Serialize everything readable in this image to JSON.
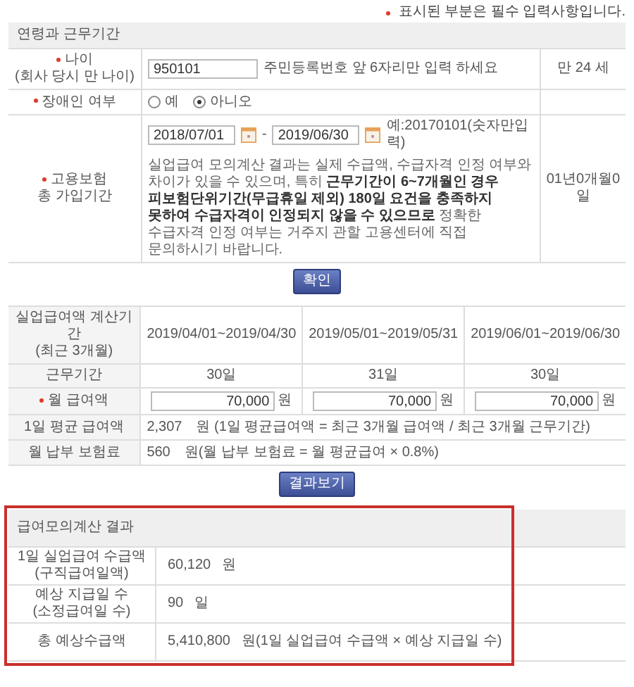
{
  "required_note": "표시된 부분은 필수 입력사항입니다.",
  "section": {
    "title": "연령과 근무기간",
    "age": {
      "label": [
        "나이",
        "(회사 당시 만 나이)"
      ],
      "required": true,
      "value": "950101",
      "hint": "주민등록번호 앞 6자리만 입력 하세요",
      "result": "만 24 세"
    },
    "disability": {
      "label": [
        "장애인 여부"
      ],
      "required": true,
      "options": [
        {
          "label": "예",
          "selected": false
        },
        {
          "label": "아니오",
          "selected": true
        }
      ]
    },
    "insurance": {
      "label": [
        "고용보험",
        "총 가입기간"
      ],
      "required": true,
      "date_from": "2018/07/01",
      "separator": "-",
      "date_to": "2019/06/30",
      "example": "예:20170101(숫자만입력)",
      "notice": "실업급여 모의계산 결과는 실제 수급액, 수급자격 인정 여부와 차이가 있을 수 있으며, 특히 **근무기간이 6~7개월인 경우 피보험단위기간(무급휴일 제외) 180일 요건을 충족하지 못하여 수급자격이 인정되지 않을 수 있으므로** 정확한 수급자격 인정 여부는 거주지 관할 고용센터에 직접 문의하시기 바랍니다.",
      "result": "01년0개월0일"
    }
  },
  "confirm_button": "확인",
  "pay_table": {
    "period_label": [
      "실업급여액 계산기간",
      "(최근 3개월)"
    ],
    "periods": [
      "2019/04/01~2019/04/30",
      "2019/05/01~2019/05/31",
      "2019/06/01~2019/06/30"
    ],
    "workdays_label": [
      "근무기간"
    ],
    "workdays": [
      "30일",
      "31일",
      "30일"
    ],
    "monthly_label": [
      "월 급여액"
    ],
    "monthly_required": true,
    "monthly": [
      {
        "value": "70,000",
        "unit": "원"
      },
      {
        "value": "70,000",
        "unit": "원"
      },
      {
        "value": "70,000",
        "unit": "원"
      }
    ],
    "daily_label": [
      "1일 평균 급여액"
    ],
    "daily_value": "2,307",
    "daily_note": "원 (1일 평균급여액 = 최근 3개월 급여액 / 최근 3개월 근무기간)",
    "premium_label": [
      "월 납부 보험료"
    ],
    "premium_value": "560",
    "premium_note": "원(월 납부 보험료 = 월 평균급여 × 0.8%)"
  },
  "result_button": "결과보기",
  "result": {
    "title": "급여모의계산 결과",
    "highlighted": true,
    "rows": [
      {
        "label": [
          "1일 실업급여 수급액",
          "(구직급여일액)"
        ],
        "value": "60,120",
        "unit": "원"
      },
      {
        "label": [
          "예상 지급일 수",
          "(소정급여일 수)"
        ],
        "value": "90",
        "unit": "일"
      },
      {
        "label": [
          "총 예상수급액"
        ],
        "value": "5,410,800",
        "unit": "원(1일 실업급여 수급액 × 예상 지급일 수)"
      }
    ]
  }
}
